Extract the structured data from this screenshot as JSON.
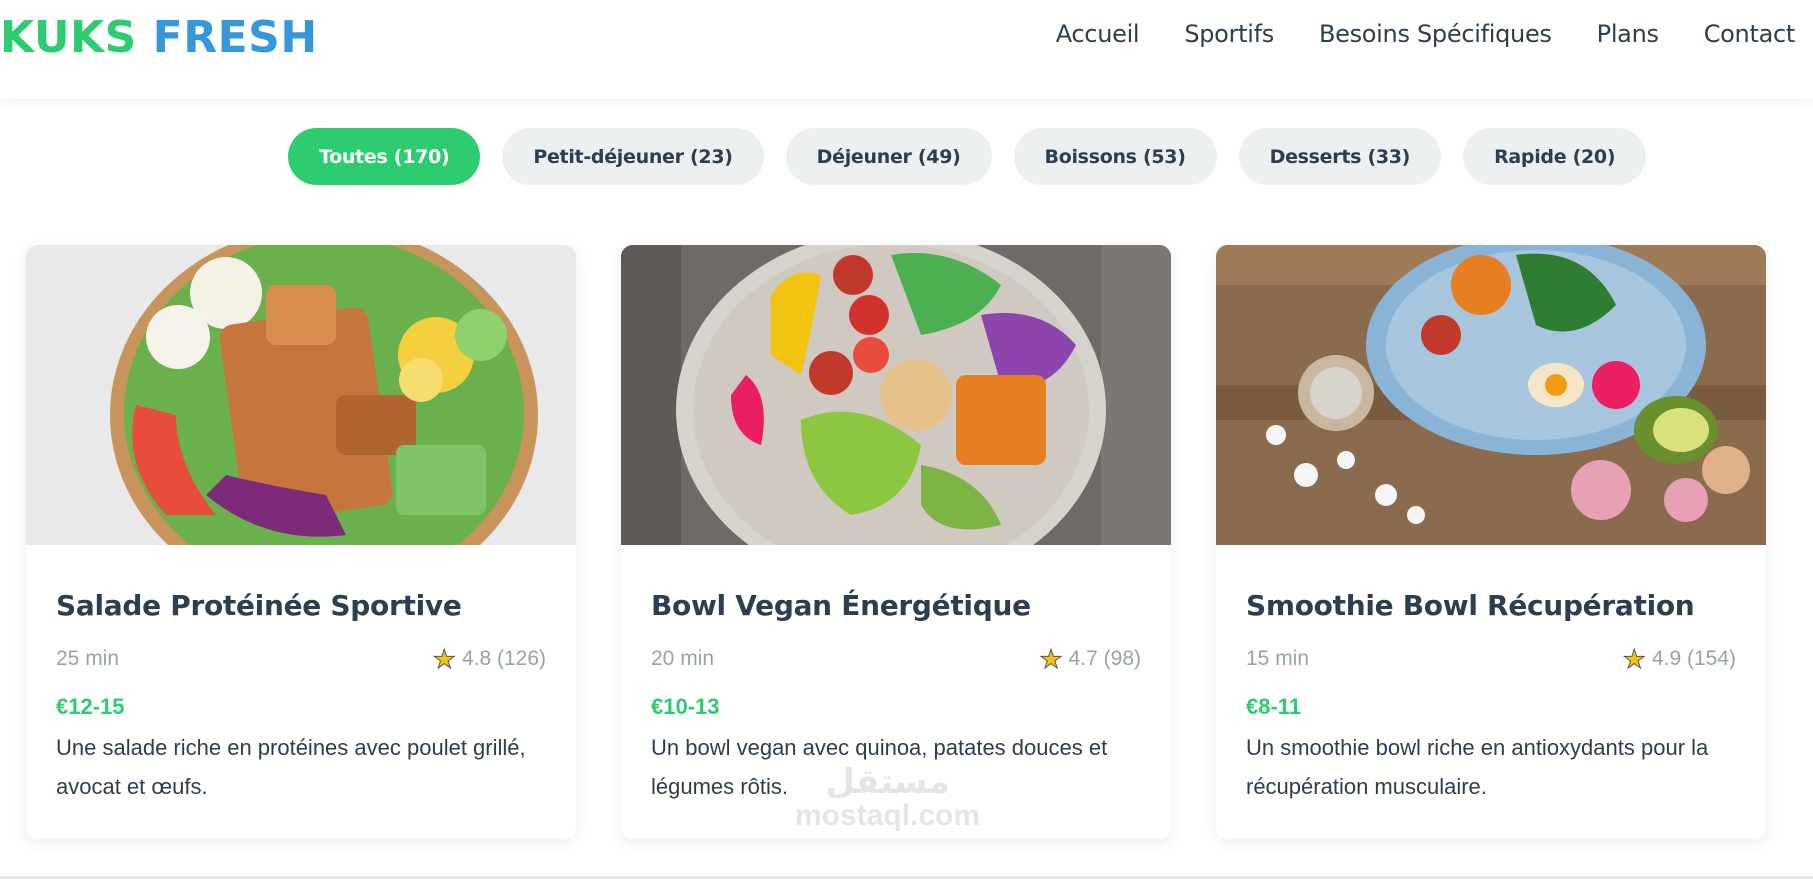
{
  "brand": {
    "part1": "KUKS",
    "part2": "FRESH"
  },
  "nav": [
    "Accueil",
    "Sportifs",
    "Besoins Spécifiques",
    "Plans",
    "Contact"
  ],
  "filters": [
    {
      "label": "Toutes (170)",
      "active": true
    },
    {
      "label": "Petit-déjeuner (23)",
      "active": false
    },
    {
      "label": "Déjeuner (49)",
      "active": false
    },
    {
      "label": "Boissons (53)",
      "active": false
    },
    {
      "label": "Desserts (33)",
      "active": false
    },
    {
      "label": "Rapide (20)",
      "active": false
    }
  ],
  "cards": [
    {
      "title": "Salade Protéinée Sportive",
      "time": "25 min",
      "rating": "4.8 (126)",
      "price": "€12-15",
      "description": "Une salade riche en protéines avec poulet grillé, avocat et œufs.",
      "image_icon": "salad-bowl-photo"
    },
    {
      "title": "Bowl Vegan Énergétique",
      "time": "20 min",
      "rating": "4.7 (98)",
      "price": "€10-13",
      "description": "Un bowl vegan avec quinoa, patates douces et légumes rôtis.",
      "image_icon": "vegan-bowl-photo"
    },
    {
      "title": "Smoothie Bowl Récupération",
      "time": "15 min",
      "rating": "4.9 (154)",
      "price": "€8-11",
      "description": "Un smoothie bowl riche en antioxydants pour la récupération musculaire.",
      "image_icon": "smoothie-bowl-photo"
    }
  ],
  "watermark": {
    "line1": "مستقل",
    "line2": "mostaql.com"
  },
  "colors": {
    "green": "#2ecc71",
    "blue": "#3498db",
    "dark": "#2c3e50",
    "muted": "#95a5a6",
    "pill": "#ecf0f1"
  }
}
